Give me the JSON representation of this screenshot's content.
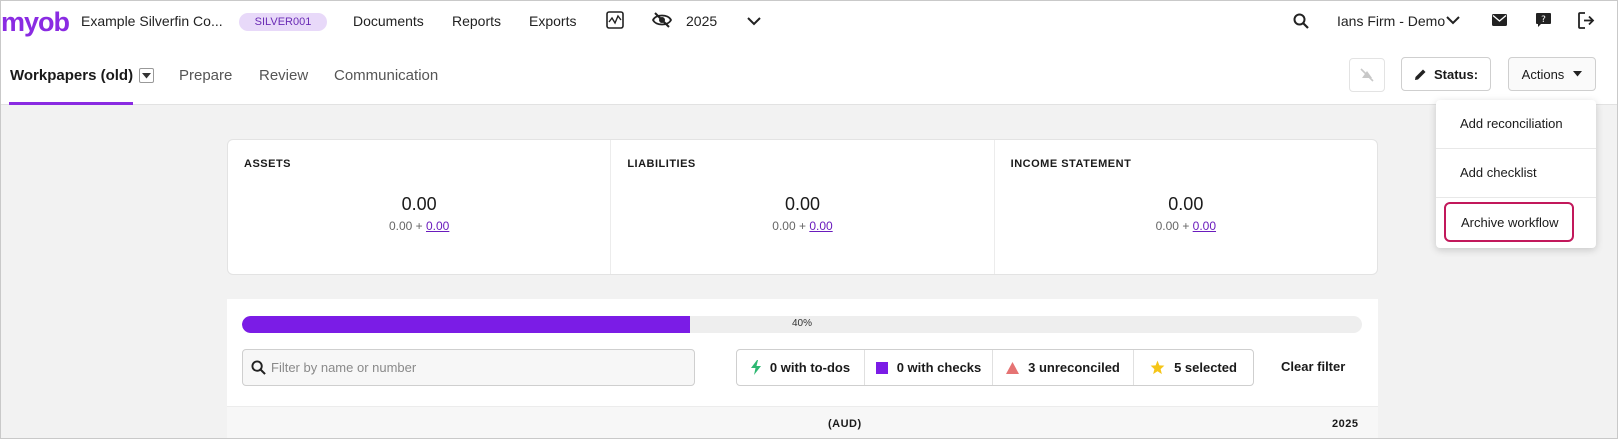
{
  "app": {
    "logo": "myob",
    "company": "Example Silverfin Co...",
    "company_code": "SILVER001",
    "year": "2025",
    "firm": "Ians Firm - Demo"
  },
  "nav": {
    "links": [
      "Documents",
      "Reports",
      "Exports"
    ]
  },
  "tabs": {
    "items": [
      "Workpapers (old)",
      "Prepare",
      "Review",
      "Communication"
    ],
    "active": "Workpapers (old)"
  },
  "toolbar": {
    "status_label": "Status:",
    "actions_label": "Actions"
  },
  "actions_menu": {
    "items": [
      "Add reconciliation",
      "Add checklist",
      "Archive workflow"
    ],
    "highlighted": "Archive workflow"
  },
  "summary": [
    {
      "label": "ASSETS",
      "value": "0.00",
      "sub_prefix": "0.00 + ",
      "sub_link": "0.00"
    },
    {
      "label": "LIABILITIES",
      "value": "0.00",
      "sub_prefix": "0.00 + ",
      "sub_link": "0.00"
    },
    {
      "label": "INCOME STATEMENT",
      "value": "0.00",
      "sub_prefix": "0.00 + ",
      "sub_link": "0.00"
    }
  ],
  "progress": {
    "percent": 40,
    "label": "40%"
  },
  "filter": {
    "search_placeholder": "Filter by name or number",
    "chips": [
      {
        "icon": "lightning-icon",
        "label": "0 with to-dos",
        "color": "#2eb872"
      },
      {
        "icon": "square-icon",
        "label": "0 with checks",
        "color": "#7b1ce6"
      },
      {
        "icon": "triangle-icon",
        "label": "3 unreconciled",
        "color": "#e57373"
      },
      {
        "icon": "star-icon",
        "label": "5 selected",
        "color": "#f5c518"
      }
    ],
    "clear_label": "Clear filter"
  },
  "table": {
    "currency_header": "(AUD)",
    "year_header": "2025"
  },
  "colors": {
    "brand": "#8a2be2",
    "progress": "#7b1ce6",
    "highlight_border": "#c2185b"
  }
}
